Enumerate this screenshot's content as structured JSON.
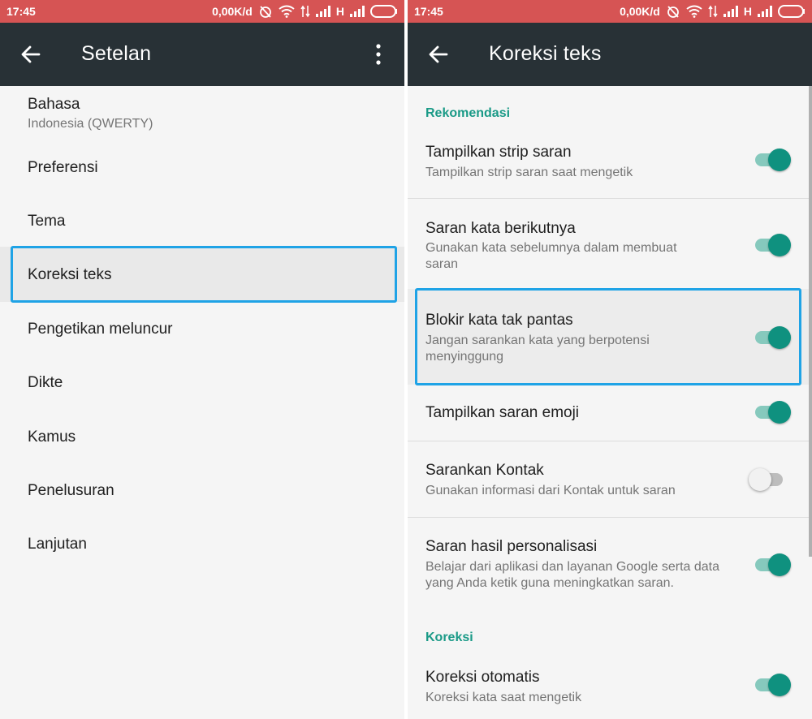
{
  "left": {
    "status": {
      "time": "17:45",
      "net_speed": "0,00K/d",
      "network_type": "H"
    },
    "toolbar": {
      "title": "Setelan",
      "back_icon": "arrow-back-icon",
      "menu_icon": "more-vert-icon"
    },
    "items": [
      {
        "label": "Bahasa",
        "sub": "Indonesia (QWERTY)"
      },
      {
        "label": "Preferensi"
      },
      {
        "label": "Tema"
      },
      {
        "label": "Koreksi teks"
      },
      {
        "label": "Pengetikan meluncur"
      },
      {
        "label": "Dikte"
      },
      {
        "label": "Kamus"
      },
      {
        "label": "Penelusuran"
      },
      {
        "label": "Lanjutan"
      }
    ]
  },
  "right": {
    "status": {
      "time": "17:45",
      "net_speed": "0,00K/d",
      "network_type": "H"
    },
    "toolbar": {
      "title": "Koreksi teks",
      "back_icon": "arrow-back-icon"
    },
    "sections": {
      "recommendation": "Rekomendasi",
      "correction": "Koreksi"
    },
    "prefs": [
      {
        "title": "Tampilkan strip saran",
        "summary": "Tampilkan strip saran saat mengetik",
        "on": true
      },
      {
        "title": "Saran kata berikutnya",
        "summary": "Gunakan kata sebelumnya dalam membuat saran",
        "on": true
      },
      {
        "title": "Blokir kata tak pantas",
        "summary": "Jangan sarankan kata yang berpotensi menyinggung",
        "on": true
      },
      {
        "title": "Tampilkan saran emoji",
        "summary": "",
        "on": true
      },
      {
        "title": "Sarankan Kontak",
        "summary": "Gunakan informasi dari Kontak untuk saran",
        "on": false
      },
      {
        "title": "Saran hasil personalisasi",
        "summary": "Belajar dari aplikasi dan layanan Google serta data yang Anda ketik guna meningkatkan saran.",
        "on": true
      },
      {
        "title": "Koreksi otomatis",
        "summary": "Koreksi kata saat mengetik",
        "on": true
      }
    ]
  },
  "colors": {
    "status_bar": "#d65454",
    "toolbar": "#283136",
    "accent": "#0f917f",
    "highlight_border": "#1fa3e6"
  }
}
